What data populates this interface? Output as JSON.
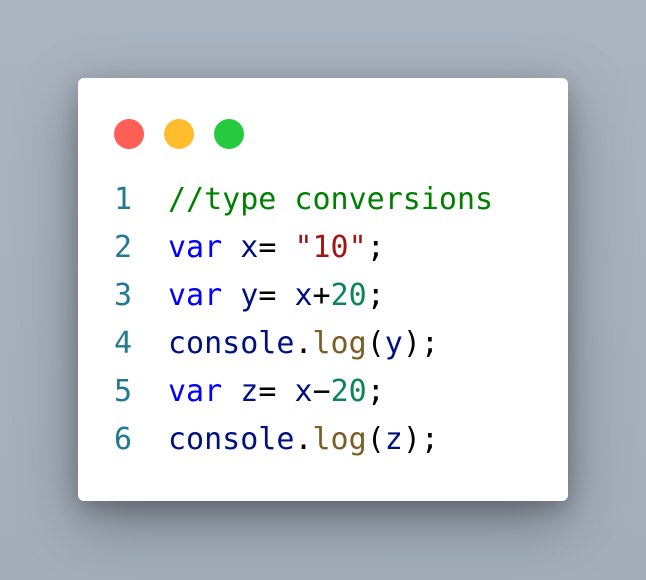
{
  "window": {
    "dots": [
      {
        "name": "close",
        "color": "#ff5f56"
      },
      {
        "name": "minimize",
        "color": "#ffbd2e"
      },
      {
        "name": "maximize",
        "color": "#27c93f"
      }
    ]
  },
  "code": {
    "lines": [
      {
        "number": "1",
        "tokens": [
          {
            "text": "//type conversions",
            "kind": "comment"
          }
        ]
      },
      {
        "number": "2",
        "tokens": [
          {
            "text": "var",
            "kind": "kw"
          },
          {
            "text": " ",
            "kind": "punc"
          },
          {
            "text": "x",
            "kind": "ident"
          },
          {
            "text": "= ",
            "kind": "punc"
          },
          {
            "text": "\"10\"",
            "kind": "str"
          },
          {
            "text": ";",
            "kind": "punc"
          }
        ]
      },
      {
        "number": "3",
        "tokens": [
          {
            "text": "var",
            "kind": "kw"
          },
          {
            "text": " ",
            "kind": "punc"
          },
          {
            "text": "y",
            "kind": "ident"
          },
          {
            "text": "= ",
            "kind": "punc"
          },
          {
            "text": "x",
            "kind": "ident"
          },
          {
            "text": "+",
            "kind": "punc"
          },
          {
            "text": "20",
            "kind": "num"
          },
          {
            "text": ";",
            "kind": "punc"
          }
        ]
      },
      {
        "number": "4",
        "tokens": [
          {
            "text": "console",
            "kind": "ident"
          },
          {
            "text": ".",
            "kind": "punc"
          },
          {
            "text": "log",
            "kind": "fn"
          },
          {
            "text": "(",
            "kind": "punc"
          },
          {
            "text": "y",
            "kind": "ident"
          },
          {
            "text": ");",
            "kind": "punc"
          }
        ]
      },
      {
        "number": "5",
        "tokens": [
          {
            "text": "var",
            "kind": "kw"
          },
          {
            "text": " ",
            "kind": "punc"
          },
          {
            "text": "z",
            "kind": "ident"
          },
          {
            "text": "= ",
            "kind": "punc"
          },
          {
            "text": "x",
            "kind": "ident"
          },
          {
            "text": "−",
            "kind": "punc"
          },
          {
            "text": "20",
            "kind": "num"
          },
          {
            "text": ";",
            "kind": "punc"
          }
        ]
      },
      {
        "number": "6",
        "tokens": [
          {
            "text": "console",
            "kind": "ident"
          },
          {
            "text": ".",
            "kind": "punc"
          },
          {
            "text": "log",
            "kind": "fn"
          },
          {
            "text": "(",
            "kind": "punc"
          },
          {
            "text": "z",
            "kind": "ident"
          },
          {
            "text": ");",
            "kind": "punc"
          }
        ]
      }
    ]
  }
}
